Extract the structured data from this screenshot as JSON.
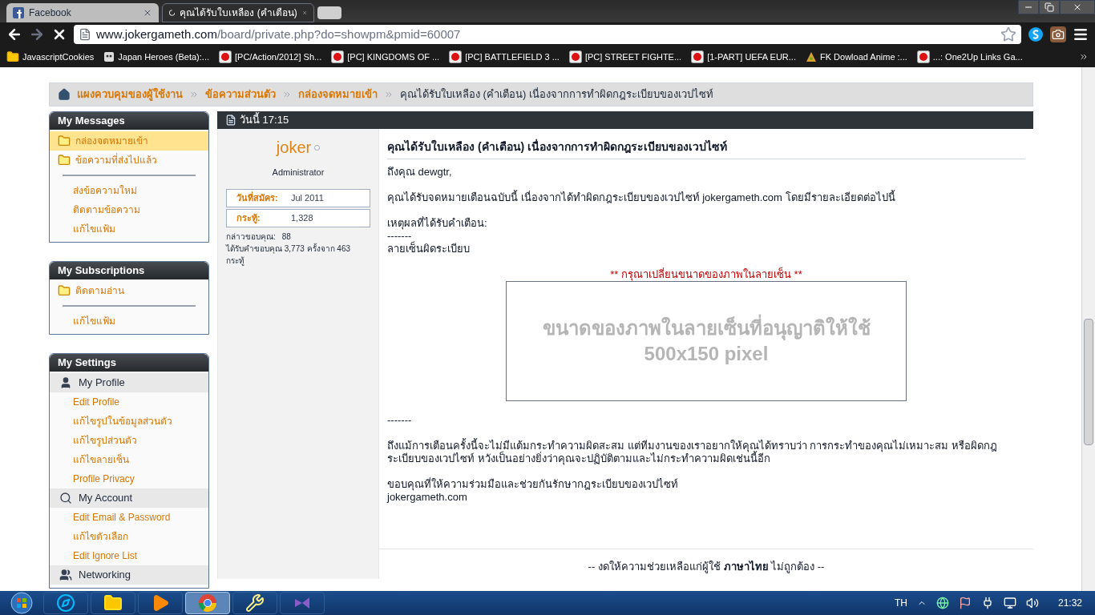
{
  "browser": {
    "tabs": [
      {
        "title": "Facebook",
        "selected": false
      },
      {
        "title": "คุณได้รับใบเหลือง (คำเตือน)",
        "selected": true
      }
    ],
    "url": {
      "host": "www.jokergameth.com",
      "path": "/board/private.php?do=showpm&pmid=60007"
    },
    "bookmarks": [
      {
        "kind": "folder",
        "label": "JavascriptCookies"
      },
      {
        "kind": "game",
        "label": "Japan Heroes (Beta):..."
      },
      {
        "kind": "page",
        "label": "[PC/Action/2012] Sh..."
      },
      {
        "kind": "page",
        "label": "[PC] KINGDOMS OF ..."
      },
      {
        "kind": "page",
        "label": "[PC] BATTLEFIELD 3 ..."
      },
      {
        "kind": "page",
        "label": "[PC] STREET FIGHTE..."
      },
      {
        "kind": "page",
        "label": "[1-PART] UEFA EUR..."
      },
      {
        "kind": "anime",
        "label": "FK Dowload Anime :..."
      },
      {
        "kind": "page",
        "label": "...: One2Up Links Ga..."
      }
    ]
  },
  "breadcrumb": [
    {
      "label": "แผงควบคุมของผู้ใช้งาน",
      "link": true
    },
    {
      "label": "ข้อความส่วนตัว",
      "link": true
    },
    {
      "label": "กล่องจดหมายเข้า",
      "link": true
    },
    {
      "label": "คุณได้รับใบเหลือง (คำเตือน) เนื่องจากการทำผิดกฎระเบียบของเวปไซท์",
      "link": false
    }
  ],
  "sidebar": [
    {
      "title": "My Messages",
      "items": [
        {
          "kind": "folder",
          "label": "กล่องจดหมายเข้า",
          "selected": true
        },
        {
          "kind": "folder",
          "label": "ข้อความที่ส่งไปแล้ว",
          "selected": false
        },
        {
          "kind": "divider"
        },
        {
          "kind": "link",
          "label": "ส่งข้อความใหม่"
        },
        {
          "kind": "link",
          "label": "ติดตามข้อความ"
        },
        {
          "kind": "link",
          "label": "แก้ไขแฟ้ม"
        }
      ]
    },
    {
      "title": "My Subscriptions",
      "items": [
        {
          "kind": "folder",
          "label": "ติดตามอ่าน",
          "selected": false
        },
        {
          "kind": "divider"
        },
        {
          "kind": "link",
          "label": "แก้ไขแฟ้ม"
        }
      ]
    },
    {
      "title": "My Settings",
      "items": [
        {
          "kind": "section",
          "label": "My Profile"
        },
        {
          "kind": "link",
          "label": "Edit Profile"
        },
        {
          "kind": "link",
          "label": "แก้ไขรูปในข้อมูลส่วนตัว"
        },
        {
          "kind": "link",
          "label": "แก้ไขรูปส่วนตัว"
        },
        {
          "kind": "link",
          "label": "แก้ไขลายเซ็น"
        },
        {
          "kind": "link",
          "label": "Profile Privacy"
        },
        {
          "kind": "section",
          "label": "My Account"
        },
        {
          "kind": "link",
          "label": "Edit Email & Password"
        },
        {
          "kind": "link",
          "label": "แก้ไขตัวเลือก"
        },
        {
          "kind": "link",
          "label": "Edit Ignore List"
        },
        {
          "kind": "section",
          "label": "Networking"
        }
      ]
    }
  ],
  "post": {
    "date": "วันนี้ 17:15",
    "author": {
      "name": "joker",
      "online": false,
      "rank": "Administrator",
      "fields": [
        {
          "label": "วันที่สมัคร:",
          "value": "Jul 2011"
        },
        {
          "label": "กระทู้:",
          "value": "1,328"
        }
      ],
      "thanks_given": {
        "label": "กล่าวขอบคุณ:",
        "value": "88"
      },
      "thanks_received": "ได้รับคำขอบคุณ 3,773 ครั้งจาก 463 กระทู้"
    },
    "title": "คุณได้รับใบเหลือง (คำเตือน) เนื่องจากการทำผิดกฎระเบียบของเวปไซท์",
    "body": [
      {
        "kind": "text",
        "lines": [
          "ถึงคุณ dewgtr,"
        ]
      },
      {
        "kind": "text",
        "lines": [
          "คุณได้รับจดหมายเตือนฉบับนี้ เนื่องจากได้ทำผิดกฎระเบียบของเวปไซท์ jokergameth.com โดยมีรายละเอียดต่อไปนี้"
        ]
      },
      {
        "kind": "text",
        "lines": [
          "เหตุผลที่ได้รับคำเตือน:",
          "-------",
          "ลายเซ็นผิดระเบียบ"
        ]
      },
      {
        "kind": "notice",
        "lines": [
          "** กรุณาเปลี่ยนขนาดของภาพในลายเซ็น **"
        ]
      },
      {
        "kind": "sample",
        "lines": [
          "ขนาดของภาพในลายเซ็นที่อนุญาติให้ใช้",
          "500x150 pixel"
        ]
      },
      {
        "kind": "text",
        "lines": [
          "-------"
        ]
      },
      {
        "kind": "text",
        "lines": [
          "ถึงแม้การเตือนครั้งนี้จะไม่มีแต้มกระทำความผิดสะสม แต่ทีมงานของเราอยากให้คุณได้ทราบว่า การกระทำของคุณไม่เหมาะสม หรือผิดกฎระเบียบของเวปไซท์ หวังเป็นอย่างยิ่งว่าคุณจะปฏิบัติตามและไม่กระทำความผิดเช่นนี้อีก"
        ]
      },
      {
        "kind": "text",
        "lines": [
          "ขอบคุณที่ให้ความร่วมมือและช่วยกันรักษากฎระเบียบของเวปไซท์",
          "jokergameth.com"
        ]
      }
    ],
    "footer": "-- งดให้ความช่วยเหลือแก่ผู้ใช้ **ภาษาไทย** ไม่ถูกต้อง --"
  },
  "taskbar": {
    "apps": [
      {
        "kind": "browser-e",
        "selected": false
      },
      {
        "kind": "folder",
        "selected": false
      },
      {
        "kind": "media",
        "selected": false
      },
      {
        "kind": "chrome",
        "selected": true
      },
      {
        "kind": "tool",
        "selected": false
      },
      {
        "kind": "studio",
        "selected": false
      }
    ],
    "language": "TH",
    "clock": "21:32"
  }
}
